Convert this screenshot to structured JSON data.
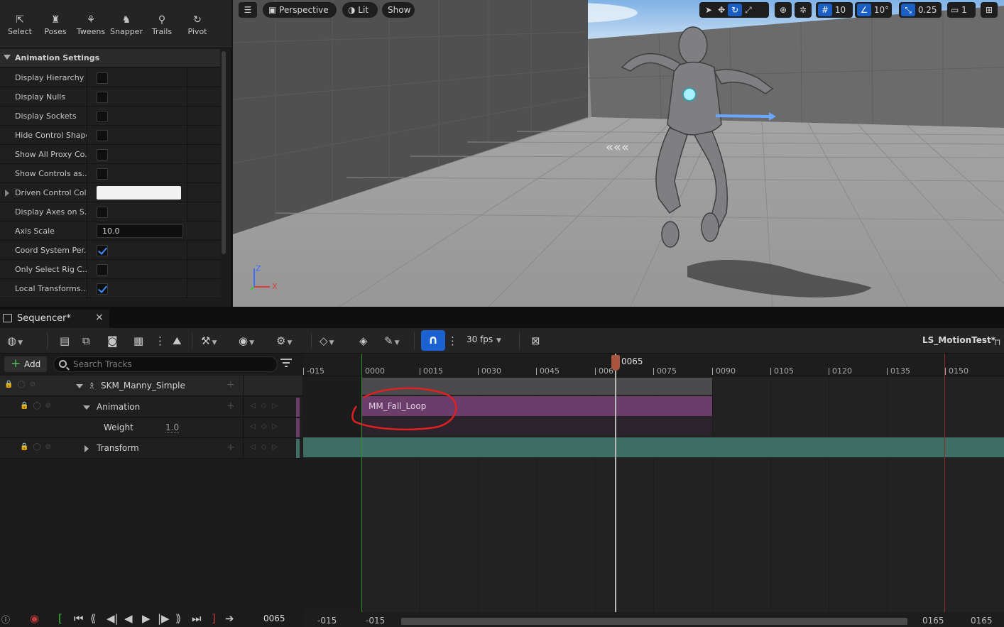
{
  "mode_toolbar": {
    "buttons": [
      {
        "label": "Select",
        "icon": "pointer-icon"
      },
      {
        "label": "Poses",
        "icon": "pose-icon"
      },
      {
        "label": "Tweens",
        "icon": "tween-icon"
      },
      {
        "label": "Snapper",
        "icon": "snapper-icon"
      },
      {
        "label": "Trails",
        "icon": "trails-icon"
      },
      {
        "label": "Pivot",
        "icon": "pivot-icon"
      }
    ]
  },
  "anim_settings": {
    "title": "Animation Settings",
    "rows": [
      {
        "label": "Display Hierarchy",
        "type": "checkbox",
        "checked": false
      },
      {
        "label": "Display Nulls",
        "type": "checkbox",
        "checked": false
      },
      {
        "label": "Display Sockets",
        "type": "checkbox",
        "checked": false
      },
      {
        "label": "Hide Control Shapes",
        "type": "checkbox",
        "checked": false
      },
      {
        "label": "Show All Proxy Co...",
        "type": "checkbox",
        "checked": false
      },
      {
        "label": "Show Controls as...",
        "type": "checkbox",
        "checked": false
      },
      {
        "label": "Driven Control Color",
        "type": "color",
        "color": "#f2f2f2"
      },
      {
        "label": "Display Axes on S...",
        "type": "checkbox",
        "checked": false
      },
      {
        "label": "Axis Scale",
        "type": "number",
        "value": "10.0"
      },
      {
        "label": "Coord System Per...",
        "type": "checkbox",
        "checked": true
      },
      {
        "label": "Only Select Rig C...",
        "type": "checkbox",
        "checked": false
      },
      {
        "label": "Local Transforms...",
        "type": "checkbox",
        "checked": true
      }
    ]
  },
  "viewport": {
    "perspective": "Perspective",
    "lit": "Lit",
    "show": "Show",
    "grid_snap": "10",
    "rot_snap": "10°",
    "scale_snap": "0.25",
    "camera_speed": "1",
    "axis_x": "X",
    "axis_z": "Z"
  },
  "sequencer": {
    "tab_title": "Sequencer*",
    "fps": "30 fps",
    "sequence_name": "LS_MotionTest*",
    "add_label": "Add",
    "search_placeholder": "Search Tracks",
    "tracks": {
      "actor": "SKM_Manny_Simple",
      "animation": "Animation",
      "weight": "Weight",
      "weight_value": "1.0",
      "transform": "Transform"
    },
    "ruler_ticks": [
      "-015",
      "0000",
      "0015",
      "0030",
      "0045",
      "006",
      "0075",
      "0090",
      "0105",
      "0120",
      "0135",
      "0150"
    ],
    "playhead_frame": "0065",
    "anim_section_label": "MM_Fall_Loop",
    "current_frame": "0065",
    "view_start": "-015",
    "view_start2": "-015",
    "view_end": "0165",
    "view_end2": "0165",
    "colors": {
      "accent_blue": "#1b62d0",
      "anim_section": "#6a3d6b",
      "transform_section": "#3e6d63",
      "playhead": "#a8553d"
    }
  }
}
